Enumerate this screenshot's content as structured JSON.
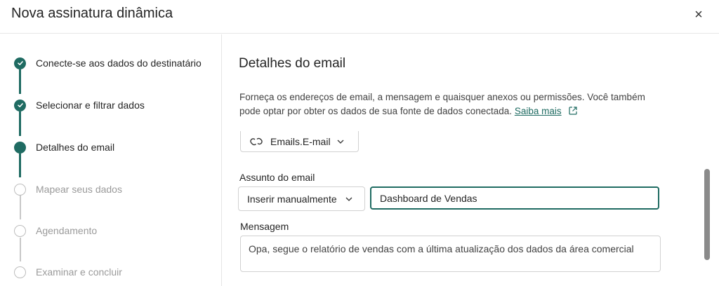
{
  "dialog": {
    "title": "Nova assinatura dinâmica",
    "close_label": "×"
  },
  "steps": [
    {
      "label": "Conecte-se aos dados do destinatário",
      "state": "done"
    },
    {
      "label": "Selecionar e filtrar dados",
      "state": "done"
    },
    {
      "label": "Detalhes do email",
      "state": "current"
    },
    {
      "label": "Mapear seus dados",
      "state": "todo"
    },
    {
      "label": "Agendamento",
      "state": "todo"
    },
    {
      "label": "Examinar e concluir",
      "state": "todo"
    }
  ],
  "main": {
    "section_title": "Detalhes do email",
    "description": "Forneça os endereços de email, a mensagem e quaisquer anexos ou permissões. Você também pode optar por obter os dados de sua fonte de dados conectada.",
    "learn_more": "Saiba mais",
    "email_field_button": "Emails.E-mail",
    "subject_label": "Assunto do email",
    "subject_mode": "Inserir manualmente",
    "subject_value": "Dashboard de Vendas",
    "message_label": "Mensagem",
    "message_value": "Opa, segue o relatório de vendas com a última atualização dos dados da área comercial"
  },
  "colors": {
    "accent": "#1f6b62",
    "muted_text": "#9a9a9a",
    "border": "#d1d1d1"
  }
}
